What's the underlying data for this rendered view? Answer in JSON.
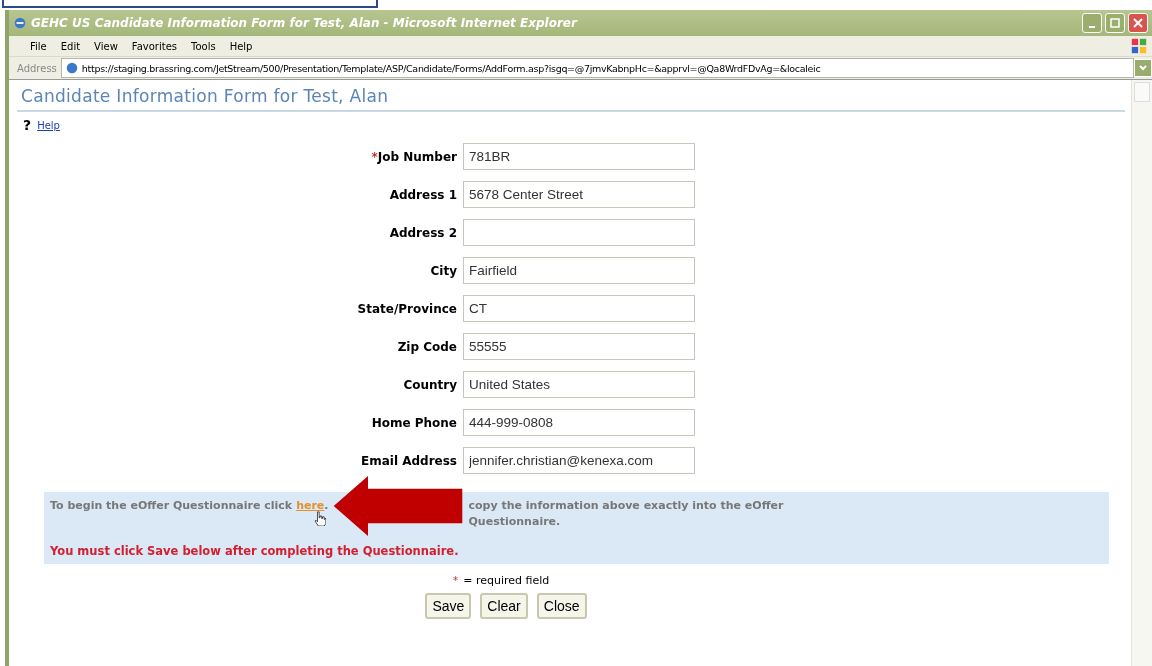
{
  "window": {
    "title": "GEHC US Candidate Information Form for Test, Alan - Microsoft Internet Explorer"
  },
  "menu": [
    "File",
    "Edit",
    "View",
    "Favorites",
    "Tools",
    "Help"
  ],
  "address_bar": {
    "label": "Address",
    "value": "https://staging.brassring.com/JetStream/500/Presentation/Template/ASP/Candidate/Forms/AddForm.asp?isgq=@7jmvKabnpHc=&apprvl=@Qa8WrdFDvAg=&localeic"
  },
  "page": {
    "heading": "Candidate Information Form for Test, Alan",
    "help_mark": "?",
    "help_link": "Help"
  },
  "fields": [
    {
      "label": "Job Number",
      "required": true,
      "value": "781BR"
    },
    {
      "label": "Address 1",
      "required": false,
      "value": "5678 Center Street"
    },
    {
      "label": "Address 2",
      "required": false
    },
    {
      "label": "City",
      "required": false,
      "value": "Fairfield"
    },
    {
      "label": "State/Province",
      "required": false,
      "value": "CT"
    },
    {
      "label": "Zip Code",
      "required": false,
      "value": "55555"
    },
    {
      "label": "Country",
      "required": false,
      "value": "United States"
    },
    {
      "label": "Home Phone",
      "required": false,
      "value": "444-999-0808"
    },
    {
      "label": "Email Address",
      "required": false,
      "value": "jennifer.christian@kenexa.com"
    }
  ],
  "notice": {
    "intro": "To begin the eOffer Questionnaire click",
    "link": "here",
    "after_link": ".",
    "rest": "copy the information above exactly into the eOffer Questionnaire.",
    "warning": "You must click Save below after completing the Questionnaire."
  },
  "legend": {
    "mark": "*",
    "text": "= required field"
  },
  "buttons": [
    "Save",
    "Clear",
    "Close"
  ]
}
